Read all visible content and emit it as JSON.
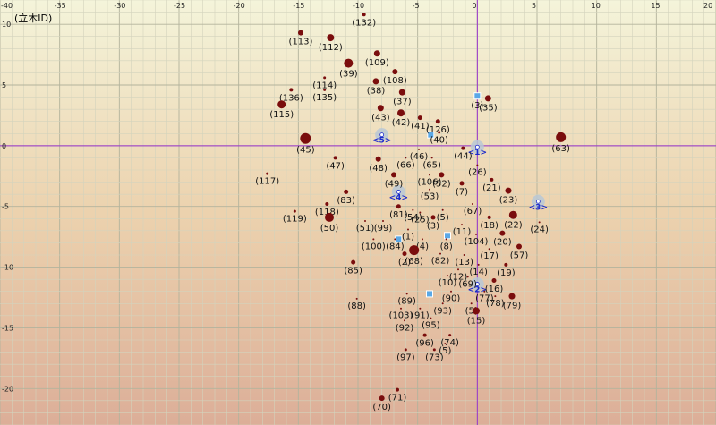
{
  "view_label": "(立木ID)",
  "colors": {
    "bg_top": "#f4f4da",
    "bg_mid": "#ecd2ae",
    "bg_bottom": "#dcae98",
    "grid_major": "#b3b39c",
    "grid_minor": "#d3d3bd",
    "axis": "#9933cc",
    "tree_fill": "#7a0d0d",
    "station_fill": "#b8c8d6",
    "marker_fill": "#5aa8e6",
    "station_text": "#1a2acc"
  },
  "chart_data": {
    "type": "scatter",
    "xlim": [
      -40,
      20
    ],
    "ylim": [
      -23,
      12
    ],
    "x_ticks": [
      -40,
      -35,
      -30,
      -25,
      -20,
      -15,
      -10,
      -5,
      0,
      5,
      10,
      15,
      20
    ],
    "y_ticks": [
      10,
      5,
      0,
      -5,
      -10,
      -15,
      -20
    ],
    "axes_lines": {
      "x": 0,
      "y": 0
    },
    "grid": true,
    "trees": [
      {
        "id": "(132)",
        "x": -9.5,
        "y": 10.8,
        "r": 2
      },
      {
        "id": "(113)",
        "x": -14.8,
        "y": 9.3,
        "r": 3
      },
      {
        "id": "(112)",
        "x": -12.3,
        "y": 8.9,
        "r": 4
      },
      {
        "id": "(109)",
        "x": -8.4,
        "y": 7.6,
        "r": 3.5
      },
      {
        "id": "(39)",
        "x": -10.8,
        "y": 6.8,
        "r": 5
      },
      {
        "id": "(108)",
        "x": -6.9,
        "y": 6.1,
        "r": 3
      },
      {
        "id": "(114)",
        "x": -12.8,
        "y": 5.6,
        "r": 1.5
      },
      {
        "id": "(38)",
        "x": -8.5,
        "y": 5.3,
        "r": 3.5
      },
      {
        "id": "(136)",
        "x": -15.6,
        "y": 4.6,
        "r": 2
      },
      {
        "id": "(135)",
        "x": -12.8,
        "y": 4.6,
        "r": 1.5
      },
      {
        "id": "(37)",
        "x": -6.3,
        "y": 4.4,
        "r": 3.5
      },
      {
        "id": "(115)",
        "x": -16.4,
        "y": 3.4,
        "r": 4.5
      },
      {
        "id": "(43)",
        "x": -8.1,
        "y": 3.1,
        "r": 3.5
      },
      {
        "id": "(42)",
        "x": -6.4,
        "y": 2.7,
        "r": 4
      },
      {
        "id": "(41)",
        "x": -4.8,
        "y": 2.3,
        "r": 2.5
      },
      {
        "id": "(126)",
        "x": -3.3,
        "y": 2.0,
        "r": 2.5
      },
      {
        "id": "(40)",
        "x": -3.2,
        "y": 1.1,
        "r": 1.5
      },
      {
        "id": "(35)",
        "x": 0.9,
        "y": 3.9,
        "r": 3.5
      },
      {
        "id": "(45)",
        "x": -14.4,
        "y": 0.6,
        "r": 6
      },
      {
        "id": "(63)",
        "x": 7.0,
        "y": 0.7,
        "r": 5.5
      },
      {
        "id": "(46)",
        "x": -4.9,
        "y": -0.3,
        "r": 1
      },
      {
        "id": "(44)",
        "x": -1.2,
        "y": -0.2,
        "r": 2
      },
      {
        "id": "(47)",
        "x": -11.9,
        "y": -1.0,
        "r": 2
      },
      {
        "id": "(48)",
        "x": -8.3,
        "y": -1.1,
        "r": 3
      },
      {
        "id": "(66)",
        "x": -6.0,
        "y": -1.0,
        "r": 1
      },
      {
        "id": "(65)",
        "x": -3.8,
        "y": -1.0,
        "r": 1
      },
      {
        "id": "(26)",
        "x": 0.0,
        "y": -1.6,
        "r": 1
      },
      {
        "id": "(117)",
        "x": -17.6,
        "y": -2.3,
        "r": 1.5
      },
      {
        "id": "(106)",
        "x": -4.0,
        "y": -2.4,
        "r": 1
      },
      {
        "id": "(52)",
        "x": -3.0,
        "y": -2.4,
        "r": 3
      },
      {
        "id": "(49)",
        "x": -7.0,
        "y": -2.4,
        "r": 3
      },
      {
        "id": "(21)",
        "x": 1.2,
        "y": -2.8,
        "r": 2
      },
      {
        "id": "(7)",
        "x": -1.3,
        "y": -3.1,
        "r": 2.5
      },
      {
        "id": "(83)",
        "x": -11.0,
        "y": -3.8,
        "r": 2.5
      },
      {
        "id": "(23)",
        "x": 2.6,
        "y": -3.7,
        "r": 3.5
      },
      {
        "id": "(53)",
        "x": -4.0,
        "y": -3.6,
        "r": 1
      },
      {
        "id": "(118)",
        "x": -12.6,
        "y": -4.8,
        "r": 2
      },
      {
        "id": "(81)",
        "x": -6.6,
        "y": -5.0,
        "r": 2.5
      },
      {
        "id": "(67)",
        "x": -0.4,
        "y": -4.8,
        "r": 1
      },
      {
        "id": "(54)",
        "x": -5.4,
        "y": -5.3,
        "r": 1
      },
      {
        "id": "(25)",
        "x": -4.8,
        "y": -5.5,
        "r": 1
      },
      {
        "id": "(5)",
        "x": -2.9,
        "y": -5.3,
        "r": 1
      },
      {
        "id": "(3)",
        "x": -3.7,
        "y": -5.9,
        "r": 2.5
      },
      {
        "id": "(119)",
        "x": -15.3,
        "y": -5.4,
        "r": 1.5
      },
      {
        "id": "(51)",
        "x": -9.4,
        "y": -6.2,
        "r": 1
      },
      {
        "id": "(99)",
        "x": -7.9,
        "y": -6.2,
        "r": 1
      },
      {
        "id": "(18)",
        "x": 1.0,
        "y": -5.9,
        "r": 2
      },
      {
        "id": "(22)",
        "x": 3.0,
        "y": -5.7,
        "r": 4.5
      },
      {
        "id": "(50)",
        "x": -12.4,
        "y": -5.9,
        "r": 5
      },
      {
        "id": "(11)",
        "x": -1.3,
        "y": -6.5,
        "r": 1
      },
      {
        "id": "(24)",
        "x": 5.2,
        "y": -6.3,
        "r": 1
      },
      {
        "id": "(1)",
        "x": -5.8,
        "y": -6.9,
        "r": 1
      },
      {
        "id": "(20)",
        "x": 2.1,
        "y": -7.2,
        "r": 3
      },
      {
        "id": "(104)",
        "x": -0.1,
        "y": -7.3,
        "r": 1
      },
      {
        "id": "(100)",
        "x": -8.7,
        "y": -7.7,
        "r": 1
      },
      {
        "id": "(84)",
        "x": -6.9,
        "y": -7.7,
        "r": 1
      },
      {
        "id": "(4)",
        "x": -4.6,
        "y": -7.7,
        "r": 1
      },
      {
        "id": "(8)",
        "x": -2.6,
        "y": -7.7,
        "r": 1
      },
      {
        "id": "(57)",
        "x": 3.5,
        "y": -8.3,
        "r": 3
      },
      {
        "id": "(17)",
        "x": 1.0,
        "y": -8.5,
        "r": 1
      },
      {
        "id": "(2)",
        "x": -6.1,
        "y": -8.9,
        "r": 2.5
      },
      {
        "id": "(68)",
        "x": -5.3,
        "y": -8.6,
        "r": 5.5
      },
      {
        "id": "(82)",
        "x": -3.1,
        "y": -8.9,
        "r": 1
      },
      {
        "id": "(13)",
        "x": -1.1,
        "y": -9.0,
        "r": 1
      },
      {
        "id": "(85)",
        "x": -10.4,
        "y": -9.6,
        "r": 2.5
      },
      {
        "id": "(14)",
        "x": 0.1,
        "y": -9.8,
        "r": 1
      },
      {
        "id": "(19)",
        "x": 2.4,
        "y": -9.8,
        "r": 2
      },
      {
        "id": "(12)",
        "x": -1.6,
        "y": -10.2,
        "r": 1
      },
      {
        "id": "(10)",
        "x": -2.5,
        "y": -10.7,
        "r": 1
      },
      {
        "id": "(69)",
        "x": -0.8,
        "y": -10.8,
        "r": 1
      },
      {
        "id": "(16)",
        "x": 1.4,
        "y": -11.1,
        "r": 2.5
      },
      {
        "id": "(90)",
        "x": -2.2,
        "y": -12.0,
        "r": 1
      },
      {
        "id": "(77)",
        "x": 0.6,
        "y": -12.0,
        "r": 1
      },
      {
        "id": "(89)",
        "x": -5.9,
        "y": -12.2,
        "r": 1
      },
      {
        "id": "(78)",
        "x": 1.5,
        "y": -12.4,
        "r": 1
      },
      {
        "id": "(79)",
        "x": 2.9,
        "y": -12.4,
        "r": 3.5
      },
      {
        "id": "(88)",
        "x": -10.1,
        "y": -12.6,
        "r": 1
      },
      {
        "id": "(93)",
        "x": -2.9,
        "y": -13.0,
        "r": 1
      },
      {
        "id": "(5)",
        "x": -0.5,
        "y": -13.0,
        "r": 1
      },
      {
        "id": "(15)",
        "x": -0.1,
        "y": -13.6,
        "r": 4
      },
      {
        "id": "(103)",
        "x": -6.4,
        "y": -13.4,
        "r": 1
      },
      {
        "id": "(91)",
        "x": -4.8,
        "y": -13.4,
        "r": 1
      },
      {
        "id": "(92)",
        "x": -6.1,
        "y": -14.4,
        "r": 1
      },
      {
        "id": "(95)",
        "x": -3.9,
        "y": -14.2,
        "r": 1
      },
      {
        "id": "(96)",
        "x": -4.4,
        "y": -15.6,
        "r": 2
      },
      {
        "id": "(74)",
        "x": -2.3,
        "y": -15.6,
        "r": 1.5
      },
      {
        "id": "(5)",
        "x": -2.7,
        "y": -16.3,
        "r": 1
      },
      {
        "id": "(97)",
        "x": -6.0,
        "y": -16.8,
        "r": 1.5
      },
      {
        "id": "(73)",
        "x": -3.6,
        "y": -16.8,
        "r": 1.5
      },
      {
        "id": "(71)",
        "x": -6.7,
        "y": -20.1,
        "r": 2
      },
      {
        "id": "(70)",
        "x": -8.0,
        "y": -20.8,
        "r": 3
      }
    ],
    "stations": [
      {
        "label": "<5>",
        "x": -8.0,
        "y": 0.9
      },
      {
        "label": "<1>",
        "x": 0.0,
        "y": -0.1
      },
      {
        "label": "<4>",
        "x": -6.6,
        "y": -3.8
      },
      {
        "label": "<3>",
        "x": 5.1,
        "y": -4.6
      },
      {
        "label": "<2>",
        "x": 0.0,
        "y": -11.4
      }
    ],
    "markers": [
      {
        "label": "(3)",
        "x": 0.0,
        "y": 4.1
      },
      {
        "label": "",
        "x": -3.9,
        "y": 0.9
      },
      {
        "label": "",
        "x": -6.6,
        "y": -7.7
      },
      {
        "label": "",
        "x": -2.5,
        "y": -7.4
      },
      {
        "label": "",
        "x": -4.0,
        "y": -12.2
      }
    ]
  }
}
